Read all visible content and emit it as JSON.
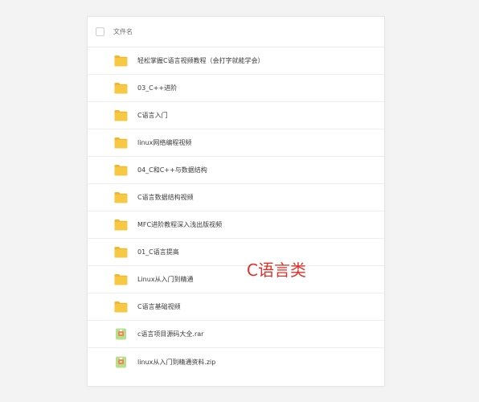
{
  "header": {
    "column_label": "文件名"
  },
  "files": [
    {
      "name": "轻松掌握C语言视频教程（会打字就能学会）",
      "type": "folder-icon"
    },
    {
      "name": "03_C++进阶",
      "type": "folder-icon"
    },
    {
      "name": "C语言入门",
      "type": "folder-icon"
    },
    {
      "name": "linux网络编程视频",
      "type": "folder-icon"
    },
    {
      "name": "04_C和C++与数据结构",
      "type": "folder-icon"
    },
    {
      "name": "C语言数据结构视频",
      "type": "folder-icon"
    },
    {
      "name": "MFC进阶教程深入浅出版视频",
      "type": "folder-icon"
    },
    {
      "name": "01_C语言提高",
      "type": "folder-icon"
    },
    {
      "name": "Linux从入门到精通",
      "type": "folder-icon"
    },
    {
      "name": "C语言基础视频",
      "type": "folder-icon"
    },
    {
      "name": "c语言项目源码大全.rar",
      "type": "archive-icon"
    },
    {
      "name": "linux从入门到精通资料.zip",
      "type": "archive-icon"
    }
  ],
  "overlay_text": "C语言类",
  "colors": {
    "folder": "#f7c843",
    "folder_tab": "#f1b72e",
    "archive_bg": "#b5e08c",
    "archive_inner": "#f08a52",
    "overlay": "#e0322c"
  }
}
